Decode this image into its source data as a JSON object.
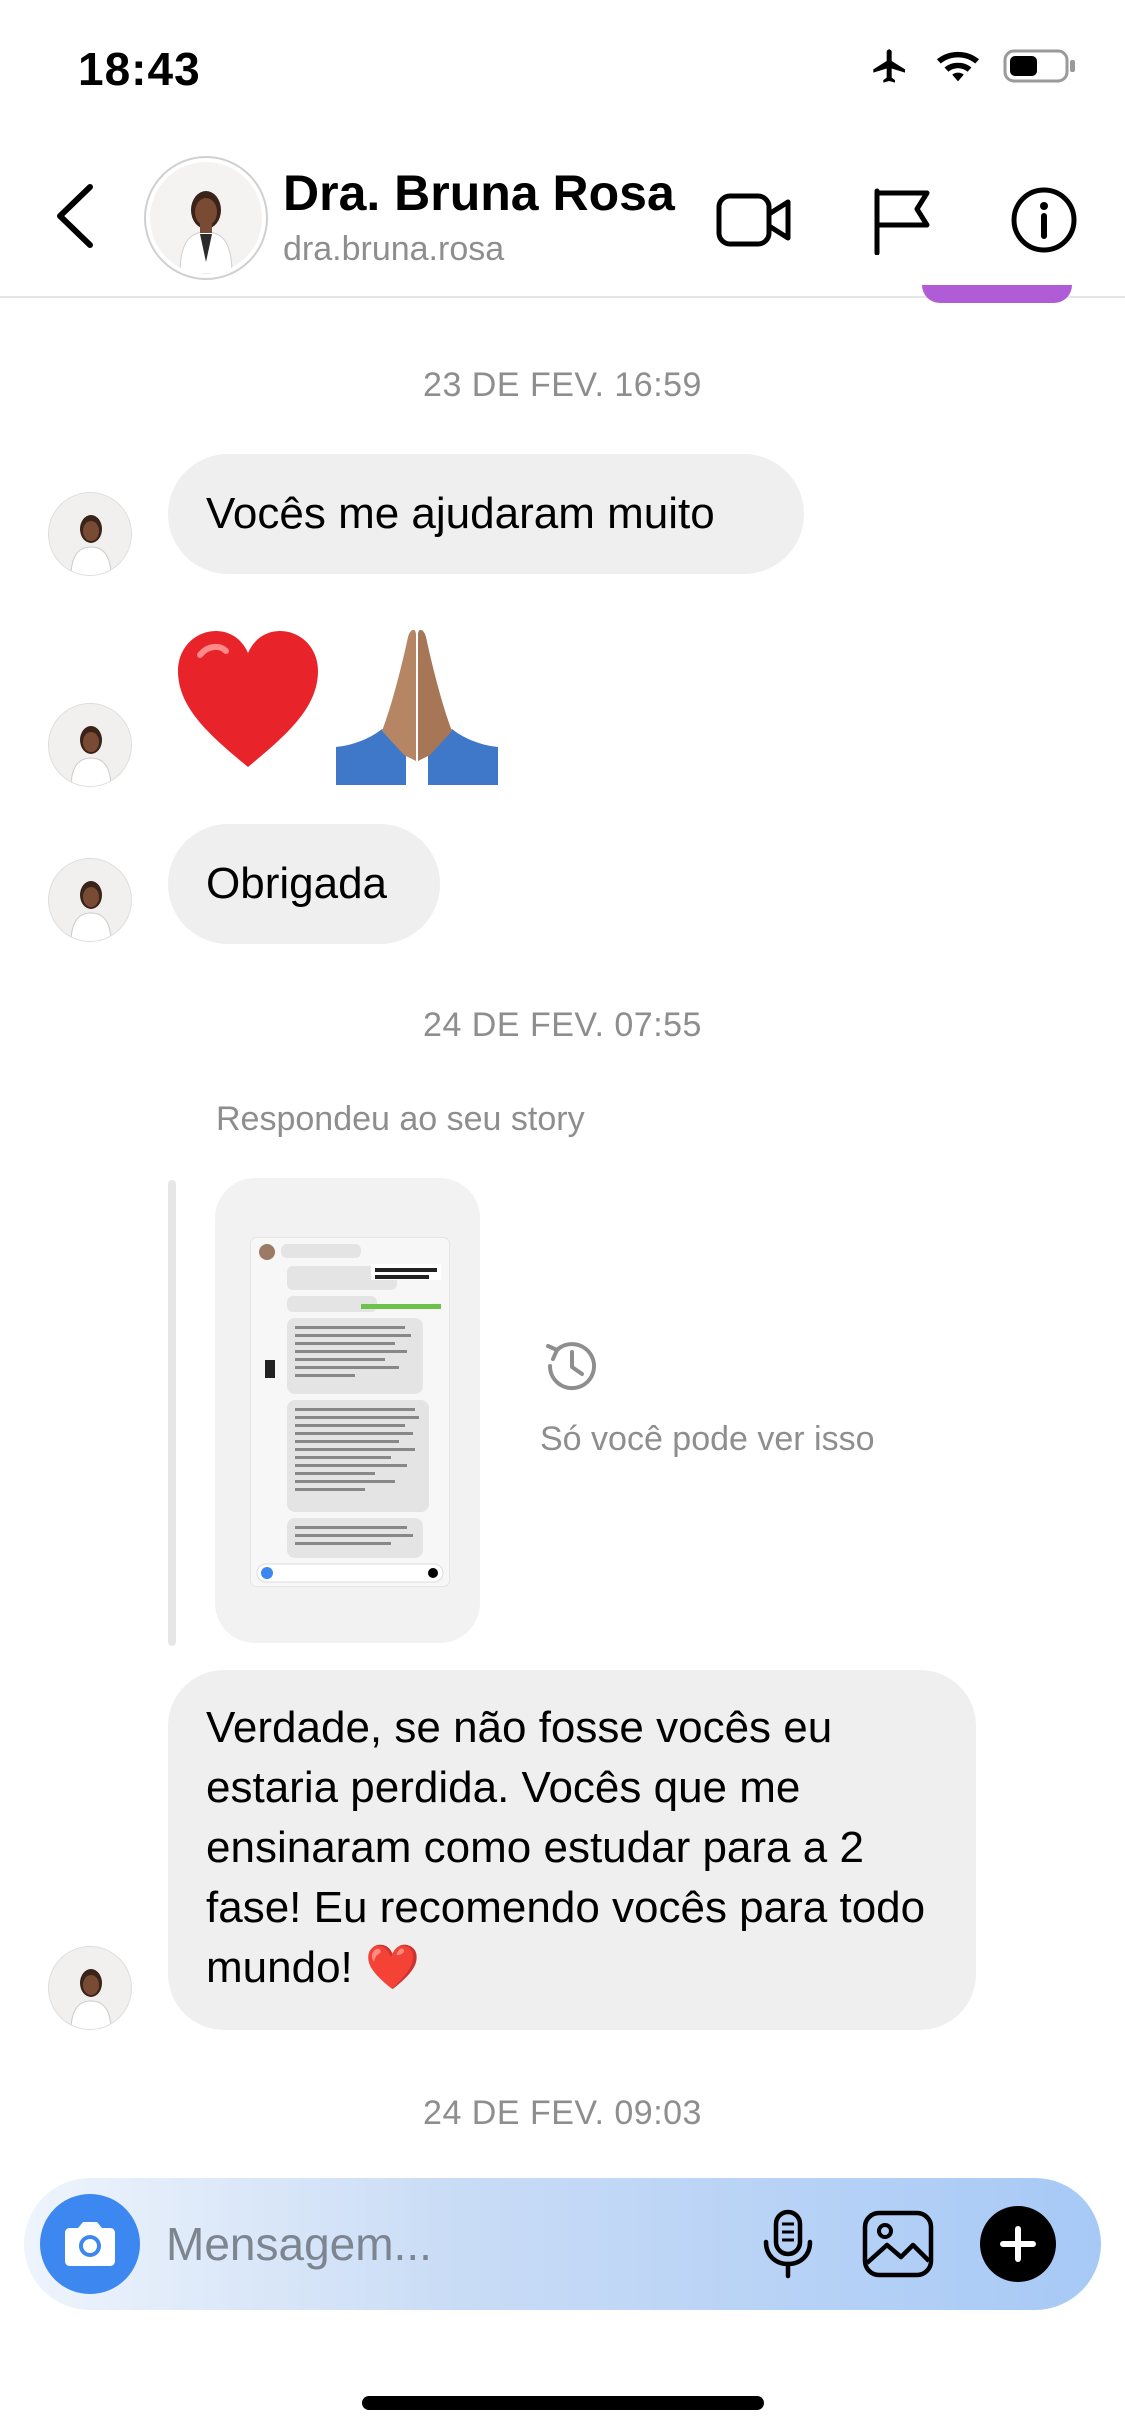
{
  "status_bar": {
    "time": "18:43"
  },
  "header": {
    "title": "Dra. Bruna Rosa",
    "username": "dra.bruna.rosa"
  },
  "messages": {
    "ts1": "23 DE FEV. 16:59",
    "msg1": "Vocês me ajudaram muito",
    "emoji_heart": "❤️",
    "msg2": "Obrigada",
    "ts2": "24 DE FEV. 07:55",
    "story_reply_label": "Respondeu ao seu story",
    "story_notice": "Só você pode ver isso",
    "msg3": "Verdade, se não fosse vocês eu estaria perdida. Vocês que me ensinaram como estudar para a 2 fase! Eu recomendo vocês para todo mundo! ❤️",
    "ts3": "24 DE FEV. 09:03"
  },
  "composer": {
    "placeholder": "Mensagem..."
  },
  "colors": {
    "accent": "#3c87f0",
    "bubble": "#efefef",
    "muted": "#8e8e8e",
    "story_tab": "#b05cd6"
  },
  "icons": [
    "back-icon",
    "video-call-icon",
    "flag-icon",
    "info-icon",
    "camera-icon",
    "microphone-icon",
    "gallery-icon",
    "plus-icon",
    "history-icon"
  ]
}
